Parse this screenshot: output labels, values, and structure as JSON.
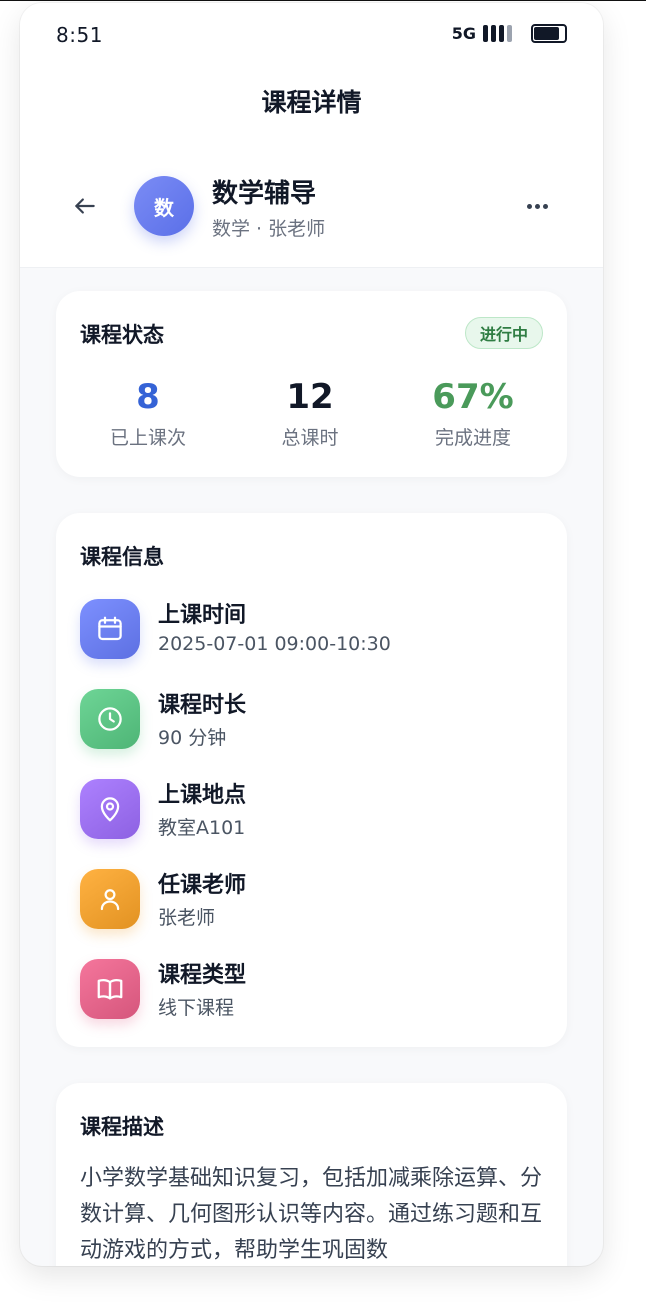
{
  "status_bar": {
    "time": "8:51",
    "network": "5G",
    "signal_level": 0.75
  },
  "header": {
    "title": "课程详情"
  },
  "course": {
    "avatar_text": "数",
    "name": "数学辅导",
    "subtitle": "数学 · 张老师"
  },
  "status_card": {
    "title": "课程状态",
    "badge": "进行中",
    "stats": [
      {
        "value": "8",
        "label": "已上课次",
        "color": "#3563d6"
      },
      {
        "value": "12",
        "label": "总课时",
        "color": "#111827"
      },
      {
        "value": "67%",
        "label": "完成进度",
        "color": "#4a9a5a"
      }
    ]
  },
  "info_card": {
    "title": "课程信息",
    "items": [
      {
        "icon": "calendar-icon",
        "label": "上课时间",
        "value": "2025-07-01 09:00-10:30",
        "color": "#6b7ef0"
      },
      {
        "icon": "clock-icon",
        "label": "课程时长",
        "value": "90 分钟",
        "color": "#5cc384"
      },
      {
        "icon": "location-pin-icon",
        "label": "上课地点",
        "value": "教室A101",
        "color": "#9b6ff0"
      },
      {
        "icon": "user-icon",
        "label": "任课老师",
        "value": "张老师",
        "color": "#f0a030"
      },
      {
        "icon": "book-icon",
        "label": "课程类型",
        "value": "线下课程",
        "color": "#e3648a"
      }
    ]
  },
  "description_card": {
    "title": "课程描述",
    "text": "小学数学基础知识复习，包括加减乘除运算、分数计算、几何图形认识等内容。通过练习题和互动游戏的方式，帮助学生巩固数"
  }
}
